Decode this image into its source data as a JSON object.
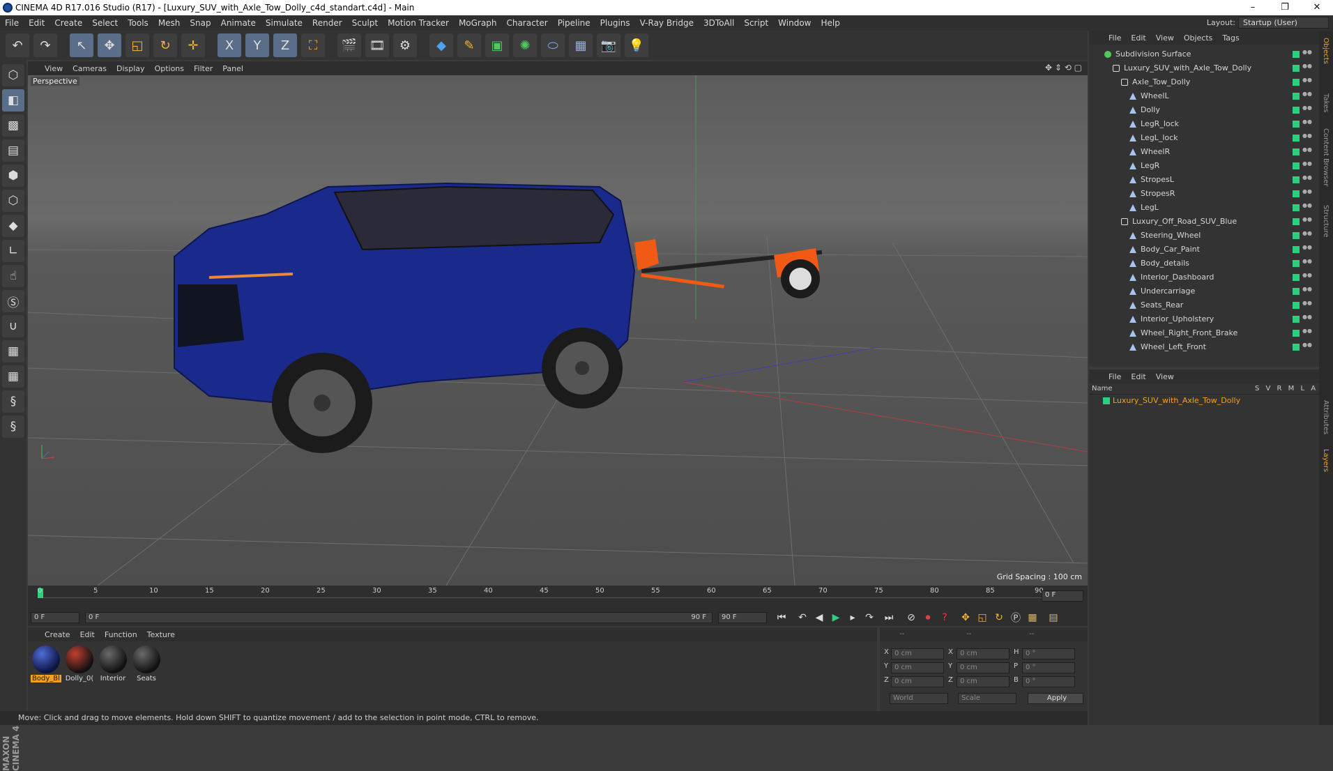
{
  "window": {
    "title": "CINEMA 4D R17.016 Studio (R17) - [Luxury_SUV_with_Axle_Tow_Dolly_c4d_standart.c4d] - Main",
    "buttons": [
      "–",
      "❐",
      "✕"
    ]
  },
  "menu": [
    "File",
    "Edit",
    "Create",
    "Select",
    "Tools",
    "Mesh",
    "Snap",
    "Animate",
    "Simulate",
    "Render",
    "Sculpt",
    "Motion Tracker",
    "MoGraph",
    "Character",
    "Pipeline",
    "Plugins",
    "V-Ray Bridge",
    "3DToAll",
    "Script",
    "Window",
    "Help"
  ],
  "layout": {
    "label": "Layout:",
    "value": "Startup (User)"
  },
  "toolbar": {
    "undo": "↶",
    "redo": "↷",
    "select": "↖",
    "move": "✥",
    "scale": "◱",
    "rotate": "↻",
    "xform": "✛",
    "x": "X",
    "y": "Y",
    "z": "Z",
    "coord": "⛶",
    "render_view": "🎬",
    "render": "🎞",
    "render_settings": "⚙",
    "cube": "◆",
    "pen": "✎",
    "subdiv": "▣",
    "array": "✺",
    "deform": "⬭",
    "floor": "▦",
    "camera": "📷",
    "light": "💡"
  },
  "viewport": {
    "menu": [
      "View",
      "Cameras",
      "Display",
      "Options",
      "Filter",
      "Panel"
    ],
    "icons": "✥ ⇕ ⟲ ▢",
    "label": "Perspective",
    "grid_spacing": "Grid Spacing : 100 cm"
  },
  "timeline": {
    "ticks": [
      "0",
      "5",
      "10",
      "15",
      "20",
      "25",
      "30",
      "35",
      "40",
      "45",
      "50",
      "55",
      "60",
      "65",
      "70",
      "75",
      "80",
      "85",
      "90"
    ],
    "frame": "0 F",
    "start": "0 F",
    "range_start": "0 F",
    "range_end": "90 F",
    "end": "90 F"
  },
  "materials": {
    "menu": [
      "Create",
      "Edit",
      "Function",
      "Texture"
    ],
    "items": [
      {
        "label": "Body_Bl"
      },
      {
        "label": "Dolly_0("
      },
      {
        "label": "Interior"
      },
      {
        "label": "Seats"
      }
    ]
  },
  "coords": {
    "headers": [
      "--",
      "--",
      "--"
    ],
    "rows": [
      {
        "a": "X",
        "av": "0 cm",
        "b": "X",
        "bv": "0 cm",
        "c": "H",
        "cv": "0 °"
      },
      {
        "a": "Y",
        "av": "0 cm",
        "b": "Y",
        "bv": "0 cm",
        "c": "P",
        "cv": "0 °"
      },
      {
        "a": "Z",
        "av": "0 cm",
        "b": "Z",
        "bv": "0 cm",
        "c": "B",
        "cv": "0 °"
      }
    ],
    "world": "World",
    "scale": "Scale",
    "apply": "Apply"
  },
  "status": "Move: Click and drag to move elements. Hold down SHIFT to quantize movement / add to the selection in point mode, CTRL to remove.",
  "objects": {
    "menu": [
      "File",
      "Edit",
      "View",
      "Objects",
      "Tags"
    ],
    "items": [
      {
        "name": "Subdivision Surface",
        "type": "sub",
        "level": 0
      },
      {
        "name": "Luxury_SUV_with_Axle_Tow_Dolly",
        "type": "null",
        "level": 1
      },
      {
        "name": "Axle_Tow_Dolly",
        "type": "null",
        "level": 2
      },
      {
        "name": "WheelL",
        "type": "bone",
        "level": 3
      },
      {
        "name": "Dolly",
        "type": "bone",
        "level": 3
      },
      {
        "name": "LegR_lock",
        "type": "bone",
        "level": 3
      },
      {
        "name": "LegL_lock",
        "type": "bone",
        "level": 3
      },
      {
        "name": "WheelR",
        "type": "bone",
        "level": 3
      },
      {
        "name": "LegR",
        "type": "bone",
        "level": 3
      },
      {
        "name": "StropesL",
        "type": "bone",
        "level": 3
      },
      {
        "name": "StropesR",
        "type": "bone",
        "level": 3
      },
      {
        "name": "LegL",
        "type": "bone",
        "level": 3
      },
      {
        "name": "Luxury_Off_Road_SUV_Blue",
        "type": "null",
        "level": 2
      },
      {
        "name": "Steering_Wheel",
        "type": "bone",
        "level": 3
      },
      {
        "name": "Body_Car_Paint",
        "type": "bone",
        "level": 3
      },
      {
        "name": "Body_details",
        "type": "bone",
        "level": 3
      },
      {
        "name": "Interior_Dashboard",
        "type": "bone",
        "level": 3
      },
      {
        "name": "Undercarriage",
        "type": "bone",
        "level": 3
      },
      {
        "name": "Seats_Rear",
        "type": "bone",
        "level": 3
      },
      {
        "name": "Interior_Upholstery",
        "type": "bone",
        "level": 3
      },
      {
        "name": "Wheel_Right_Front_Brake",
        "type": "bone",
        "level": 3
      },
      {
        "name": "Wheel_Left_Front",
        "type": "bone",
        "level": 3
      }
    ]
  },
  "layers": {
    "menu": [
      "File",
      "Edit",
      "View"
    ],
    "header_name": "Name",
    "header_flags": "S V R M L A",
    "items": [
      {
        "name": "Luxury_SUV_with_Axle_Tow_Dolly",
        "color": "#2ecf7c"
      }
    ]
  },
  "right_tabs": [
    "Objects",
    "Takes",
    "Content Browser",
    "Structure",
    "Attributes",
    "Layers"
  ]
}
